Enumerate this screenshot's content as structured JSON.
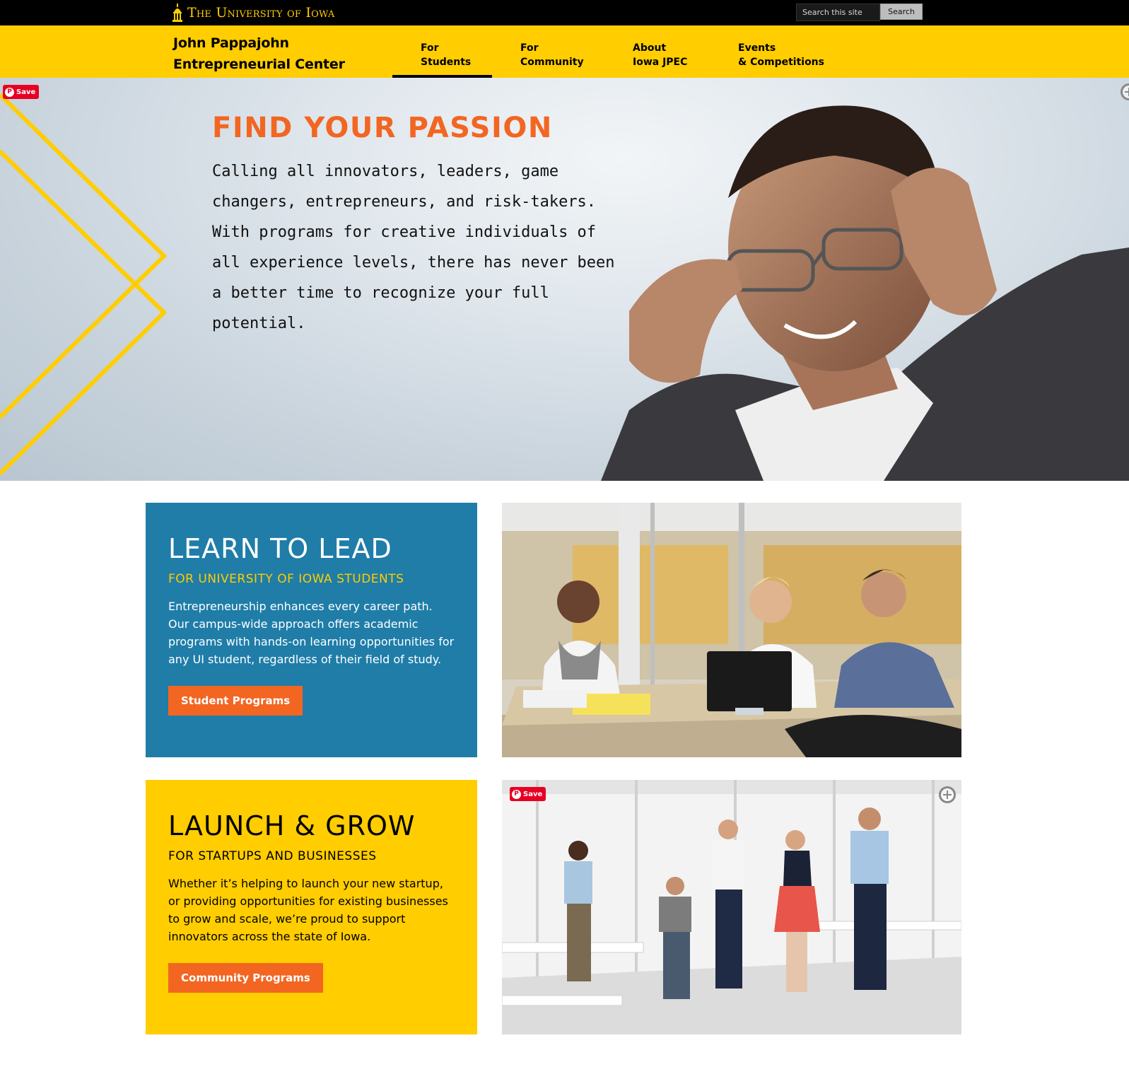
{
  "colors": {
    "black_bar": "#000000",
    "iowa_gold": "#FFCD00",
    "accent_orange": "#F26622",
    "card_blue": "#1F7DA8",
    "pinterest_red": "#E60023"
  },
  "header": {
    "university": "The University of Iowa",
    "search": {
      "placeholder": "Search this site",
      "value": "",
      "button_label": "Search"
    }
  },
  "nav": {
    "center_name_line1": "John Pappajohn",
    "center_name_line2": "Entrepreneurial Center",
    "items": [
      {
        "line1": "For",
        "line2": "Students",
        "active": true
      },
      {
        "line1": "For",
        "line2": "Community",
        "active": false
      },
      {
        "line1": "About",
        "line2": "Iowa JPEC",
        "active": false
      },
      {
        "line1": "Events",
        "line2": "& Competitions",
        "active": false
      }
    ]
  },
  "hero": {
    "title": "FIND YOUR PASSION",
    "text": "Calling all innovators, leaders, game changers, entrepreneurs, and risk-takers. With programs for creative individuals of all experience levels, there has never been a better time to recognize your full potential.",
    "pin_label": "Save",
    "pin_icon": "pinterest-icon",
    "expand_icon": "expand-icon"
  },
  "cards": [
    {
      "title": "LEARN TO LEAD",
      "subtitle": "FOR UNIVERSITY OF IOWA STUDENTS",
      "text": "Entrepreneurship enhances every career path. Our campus-wide approach offers academic programs with hands-on learning opportunities for any UI student, regardless of their field of study.",
      "button": "Student Programs"
    },
    {
      "title": "LAUNCH & GROW",
      "subtitle": "FOR STARTUPS AND BUSINESSES",
      "text": "Whether it’s helping to launch your new startup, or providing opportunities for existing businesses to grow and scale, we’re proud to support innovators across the state of Iowa.",
      "button": "Community Programs"
    }
  ],
  "photos": {
    "team_pin_label": "Save"
  }
}
